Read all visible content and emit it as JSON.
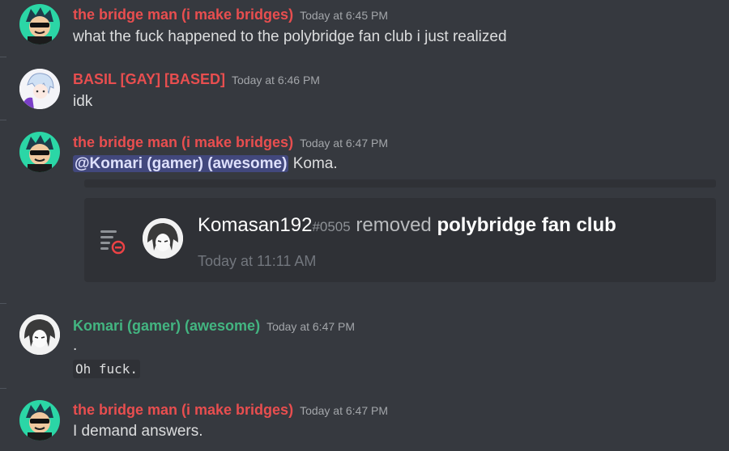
{
  "colors": {
    "background": "#36393f",
    "name_red": "#e84e4f",
    "name_green": "#43b581",
    "mention_bg": "#5865f2",
    "embed_bg": "#2f3136"
  },
  "messages": [
    {
      "author": "the bridge man (i make bridges)",
      "timestamp": "Today at 6:45 PM",
      "text": "what the fuck happened to the polybridge fan club i just realized",
      "avatar_icon": "sunglasses-avatar-icon"
    },
    {
      "author": "BASIL [GAY] [BASED]",
      "timestamp": "Today at 6:46 PM",
      "text": "idk",
      "avatar_icon": "anime-avatar-icon"
    },
    {
      "author": "the bridge man (i make bridges)",
      "timestamp": "Today at 6:47 PM",
      "mention": "@Komari (gamer) (awesome)",
      "text": " Koma.",
      "avatar_icon": "sunglasses-avatar-icon",
      "embed": {
        "user": "Komasan192",
        "discriminator": "#0505",
        "action": " removed ",
        "target": "polybridge fan club",
        "time": "Today at 11:11 AM",
        "icon": "removed-list-icon"
      }
    },
    {
      "author": "Komari (gamer) (awesome)",
      "timestamp": "Today at 6:47 PM",
      "text": ".",
      "code": "Oh fuck.",
      "avatar_icon": "manga-avatar-icon"
    },
    {
      "author": "the bridge man (i make bridges)",
      "timestamp": "Today at 6:47 PM",
      "text": "I demand answers.",
      "avatar_icon": "sunglasses-avatar-icon"
    }
  ]
}
